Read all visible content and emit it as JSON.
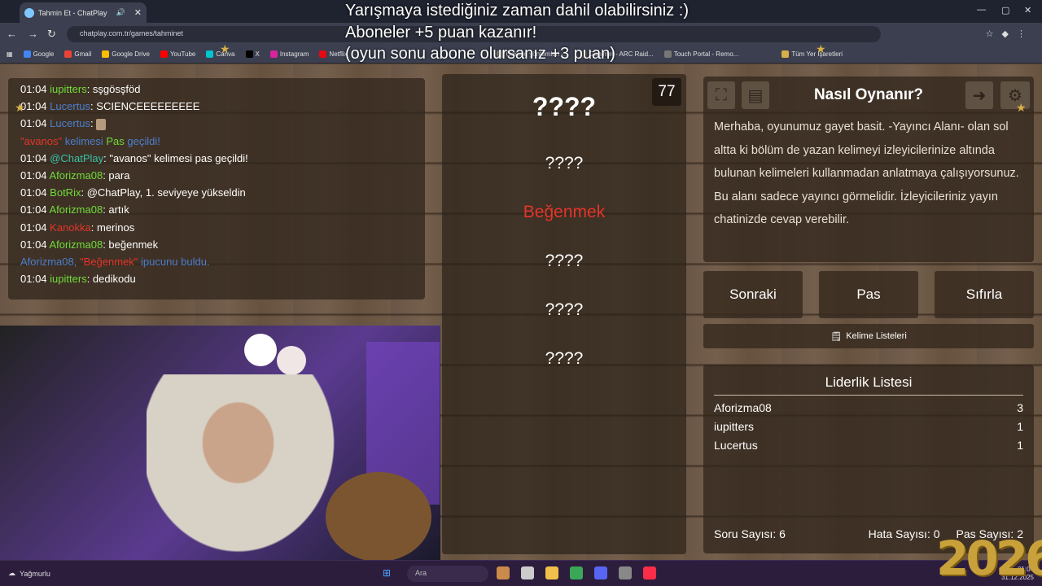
{
  "browser": {
    "tab_title": "Tahmin Et - ChatPlay",
    "url": "chatplay.com.tr/games/tahminet",
    "bookmarks": [
      "Google",
      "Gmail",
      "Google Drive",
      "YouTube",
      "Canva",
      "X",
      "Instagram",
      "Netflix",
      "Ödeme yöntemleri -...",
      "Ganimet - ARC Raid...",
      "Touch Portal - Remo..."
    ],
    "all_bookmarks": "Tüm Yer İşaretleri"
  },
  "stream_overlay": {
    "line1": "Yarışmaya istediğiniz zaman dahil olabilirsiniz :)",
    "line2": "Aboneler +5 puan kazanır!",
    "line3": "(oyun sonu abone olursanız +3 puan)"
  },
  "chat": [
    {
      "time": "01:04",
      "user": "iupitters",
      "user_color": "green",
      "msg": ": sşgösşföd"
    },
    {
      "time": "01:04",
      "user": "Lucertus",
      "user_color": "blue",
      "msg": ": SCIENCEEEEEEEEE"
    },
    {
      "time": "01:04",
      "user": "Lucertus",
      "user_color": "blue",
      "msg": ":"
    },
    {
      "system": true,
      "parts": [
        "\"avanos\"",
        " kelimesi ",
        "Pas",
        " geçildi!"
      ]
    },
    {
      "time": "01:04",
      "user": "@ChatPlay",
      "user_color": "teal",
      "msg": ": \"avanos\" kelimesi pas geçildi!"
    },
    {
      "time": "01:04",
      "user": "Aforizma08",
      "user_color": "green",
      "msg": ": para"
    },
    {
      "time": "01:04",
      "user": "BotRix",
      "user_color": "green",
      "msg": ": @ChatPlay, 1. seviyeye yükseldin"
    },
    {
      "time": "01:04",
      "user": "Aforizma08",
      "user_color": "green",
      "msg": ": artık"
    },
    {
      "time": "01:04",
      "user": "Kanokka",
      "user_color": "red",
      "msg": ": merinos"
    },
    {
      "time": "01:04",
      "user": "Aforizma08",
      "user_color": "green",
      "msg": ": beğenmek"
    },
    {
      "hint": true,
      "parts": [
        "Aforizma08, ",
        "\"Beğenmek\"",
        " ipucunu buldu."
      ]
    },
    {
      "time": "01:04",
      "user": "iupitters",
      "user_color": "green",
      "msg": ": dedikodu"
    }
  ],
  "game": {
    "timer": "77",
    "words": [
      "????",
      "????",
      "Beğenmek",
      "????",
      "????",
      "????"
    ]
  },
  "howto": {
    "title": "Nasıl Oynanır?",
    "body": "Merhaba, oyunumuz gayet basit. -Yayıncı Alanı- olan sol altta ki bölüm de yazan kelimeyi izleyicilerinize altında bulunan kelimeleri kullanmadan anlatmaya çalışıyorsunuz. Bu alanı sadece yayıncı görmelidir. İzleyicileriniz yayın chatinizde cevap verebilir."
  },
  "buttons": {
    "next": "Sonraki",
    "pass": "Pas",
    "reset": "Sıfırla",
    "word_lists": "Kelime Listeleri"
  },
  "leaderboard": {
    "title": "Liderlik Listesi",
    "rows": [
      {
        "name": "Aforizma08",
        "score": "3"
      },
      {
        "name": "iupitters",
        "score": "1"
      },
      {
        "name": "Lucertus",
        "score": "1"
      }
    ],
    "questions": "Soru Sayısı: 6",
    "errors": "Hata Sayısı: 0",
    "passes": "Pas Sayısı: 2"
  },
  "taskbar": {
    "weather": "Yağmurlu",
    "search": "Ara",
    "time": "01:04",
    "date": "31.12.2025"
  },
  "year_badge": "2026",
  "colors": {
    "green": "#6fdc3a",
    "blue": "#4c7fd0",
    "red": "#e4352b",
    "teal": "#37c0a8"
  }
}
